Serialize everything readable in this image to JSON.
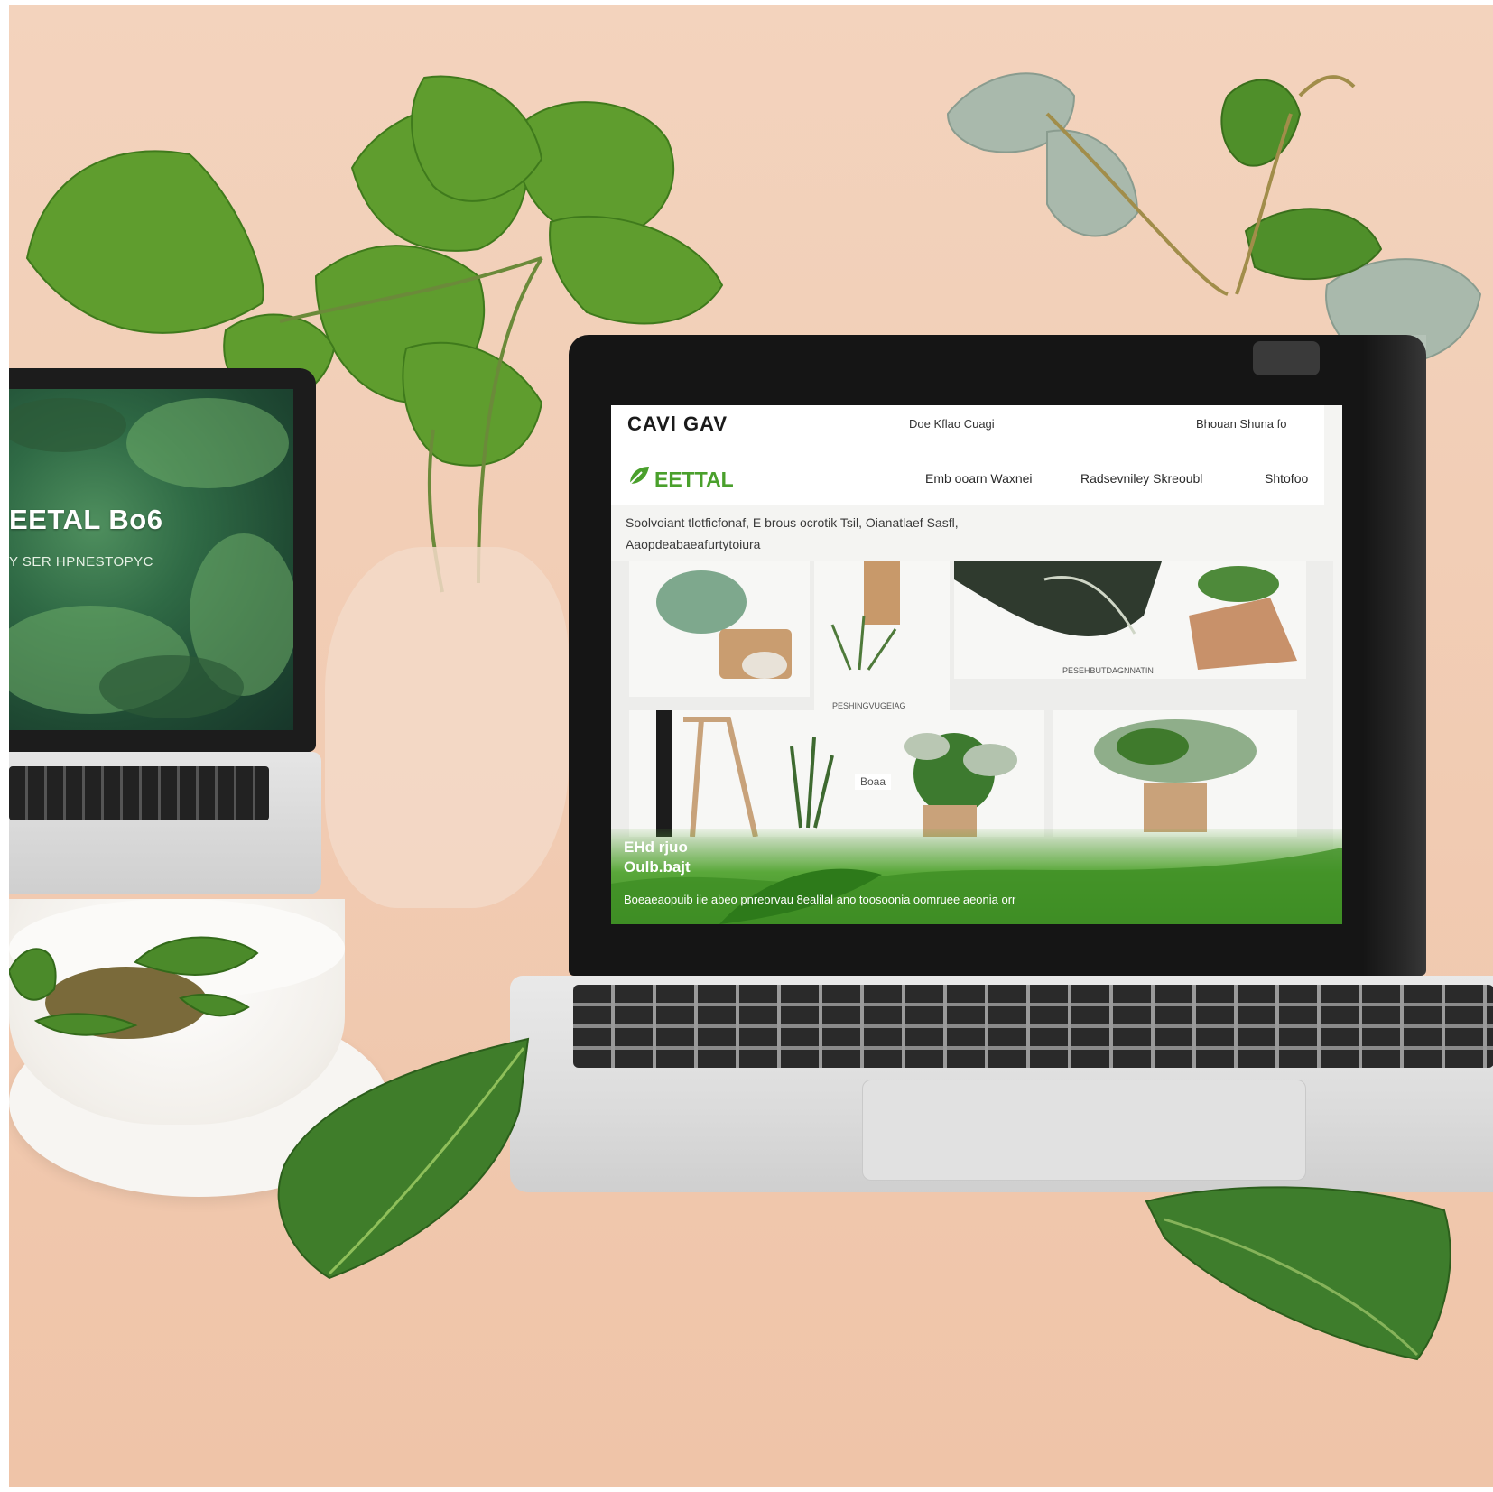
{
  "left_laptop": {
    "title": "EETAL Bo6",
    "subtitle": "Y SER HPNESTOPYC"
  },
  "main_site": {
    "brand": "CAVl  GAV",
    "top_links": "Doe  Kflao Cuagi",
    "top_right": "Bhouan Shuna fo",
    "logo_text": "EETTAL",
    "nav": [
      "Emb ooarn Waxnei",
      "Radsevniley Skreoubl",
      "Shtofoo"
    ],
    "intro_line_1": "Soolvoiant tlotficfonaf, E brous ocrotik Tsil, Oianatlaef Sasfl,",
    "intro_line_2": "Aaopdeabaeafurtytoiura",
    "gallery_labels": {
      "tile_2": "PESHINGVUGEIAG",
      "tile_3": "PESEHBUTDAGNNATIN",
      "tile_5": "Boaa"
    },
    "hero_line_1": "EHd rjuo",
    "hero_line_2": "Oulb.bajt",
    "hero_small": "Boeaeaopuib iie abeo pnreorvau 8ealilal  ano toosoonia oomruee aeonia orr"
  },
  "colors": {
    "background": "#f1cbb2",
    "brand_green": "#4aa02c",
    "leaf_green": "#4e8f2a",
    "eucalyptus": "#9fb3a6"
  }
}
